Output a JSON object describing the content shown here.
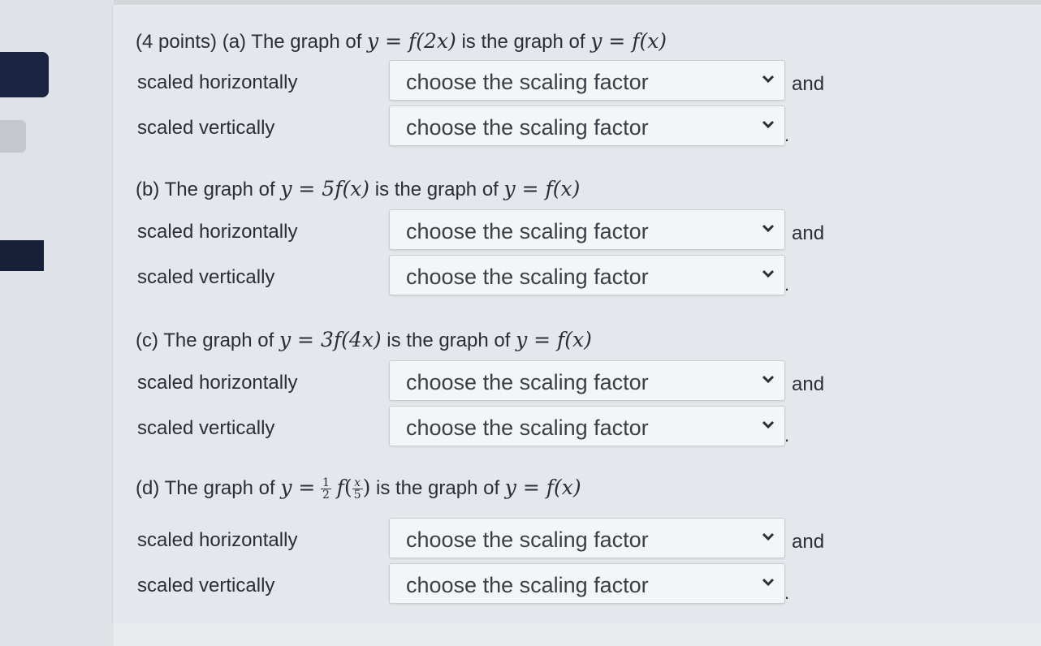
{
  "placeholder": "choose the scaling factor",
  "labels": {
    "horizontal": "scaled horizontally",
    "vertical": "scaled vertically",
    "and": "and",
    "period": "."
  },
  "parts": [
    {
      "prefix": "(4 points) (a) The graph of",
      "expr": "y = f(2x)",
      "middle": "is the graph of",
      "base": "y = f(x)"
    },
    {
      "prefix": "(b) The graph of",
      "expr": "y = 5f(x)",
      "middle": "is the graph of",
      "base": "y = f(x)"
    },
    {
      "prefix": "(c) The graph of",
      "expr": "y = 3f(4x)",
      "middle": "is the graph of",
      "base": "y = f(x)"
    },
    {
      "prefix": "(d) The graph of",
      "expr_lead": "y =",
      "frac1_num": "1",
      "frac1_den": "2",
      "expr_f": "f",
      "frac2_num": "x",
      "frac2_den": "5",
      "middle": "is the graph of",
      "base": "y = f(x)"
    }
  ]
}
